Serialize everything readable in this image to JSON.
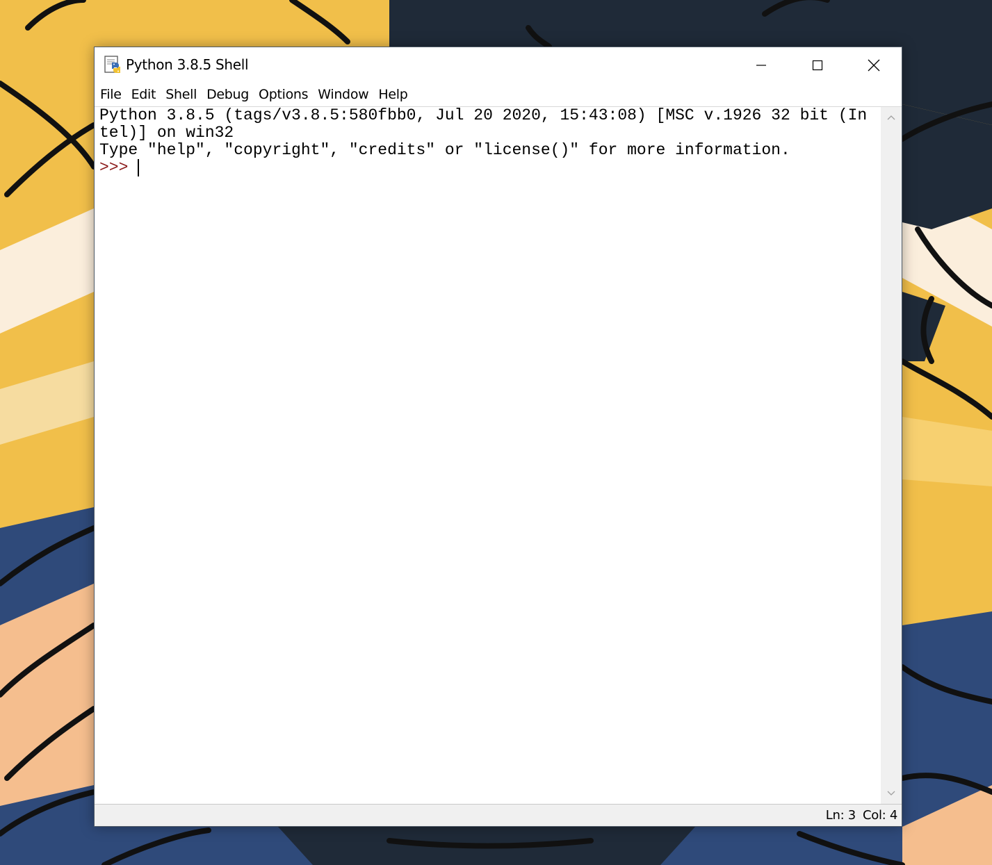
{
  "window": {
    "title": "Python 3.8.5 Shell",
    "icon": "idle-python-icon",
    "controls": [
      "minimize-icon",
      "maximize-icon",
      "close-icon"
    ]
  },
  "menu": {
    "items": [
      {
        "label": "File"
      },
      {
        "label": "Edit"
      },
      {
        "label": "Shell"
      },
      {
        "label": "Debug"
      },
      {
        "label": "Options"
      },
      {
        "label": "Window"
      },
      {
        "label": "Help"
      }
    ]
  },
  "shell": {
    "lines": [
      "Python 3.8.5 (tags/v3.8.5:580fbb0, Jul 20 2020, 15:43:08) [MSC v.1926 32 bit (In",
      "tel)] on win32",
      "Type \"help\", \"copyright\", \"credits\" or \"license()\" for more information."
    ],
    "prompt": ">>> "
  },
  "status": {
    "line": "Ln: 3",
    "col": "Col: 4"
  },
  "colors": {
    "prompt": "#8b1a1a",
    "wallpaper_yellow": "#f2c14e",
    "wallpaper_navy": "#1f2a38",
    "wallpaper_blue": "#2f4a7a"
  }
}
